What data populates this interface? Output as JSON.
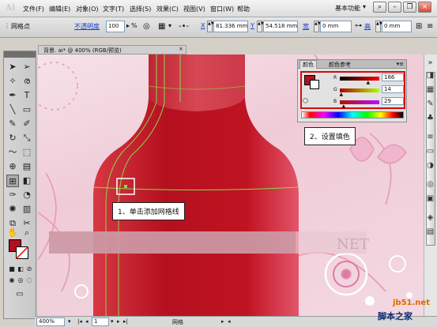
{
  "app": {
    "logo": "Ai",
    "workspace": "基本功能",
    "menu": [
      "文件(F)",
      "编辑(E)",
      "对象(O)",
      "文字(T)",
      "选择(S)",
      "效果(C)",
      "视图(V)",
      "窗口(W)",
      "帮助"
    ]
  },
  "controlbar": {
    "mode_label": "网格点",
    "opacity_label": "不透明度",
    "opacity_value": "100",
    "opacity_unit": "%",
    "x_label": "X",
    "x_value": "81.336 mm",
    "y_label": "Y",
    "y_value": "54.518 mm",
    "w_label": "宽",
    "w_value": "0 mm",
    "h_label": "高",
    "h_value": "0 mm"
  },
  "document": {
    "tab_title": "背景. ai* @ 400% (RGB/预览)",
    "close": "×"
  },
  "color_panel": {
    "tabs": [
      "颜色",
      "颜色参考"
    ],
    "menu_icon": "▾≡",
    "channels": [
      {
        "label": "R",
        "value": "186",
        "level": 0.73,
        "gradient": [
          "#000000",
          "#ff0000"
        ]
      },
      {
        "label": "G",
        "value": "14",
        "level": 0.05,
        "gradient": [
          "#b00000",
          "#b0ff00"
        ]
      },
      {
        "label": "B",
        "value": "29",
        "level": 0.11,
        "gradient": [
          "#ba0e00",
          "#ba0eff"
        ]
      }
    ],
    "fill_color": "#ba0e1d"
  },
  "callouts": {
    "step1": "1、单击添加网格线",
    "step2": "2、设置填色"
  },
  "statusbar": {
    "zoom": "400%",
    "page": "1",
    "tool_name": "网格"
  },
  "watermark": {
    "site": "jb51.net",
    "name": "脚本之家",
    "faint_text": "NET"
  },
  "colors": {
    "accent_red": "#d40b0b",
    "bottle_red": "#b01020",
    "mesh_line": "#8bd84a"
  }
}
